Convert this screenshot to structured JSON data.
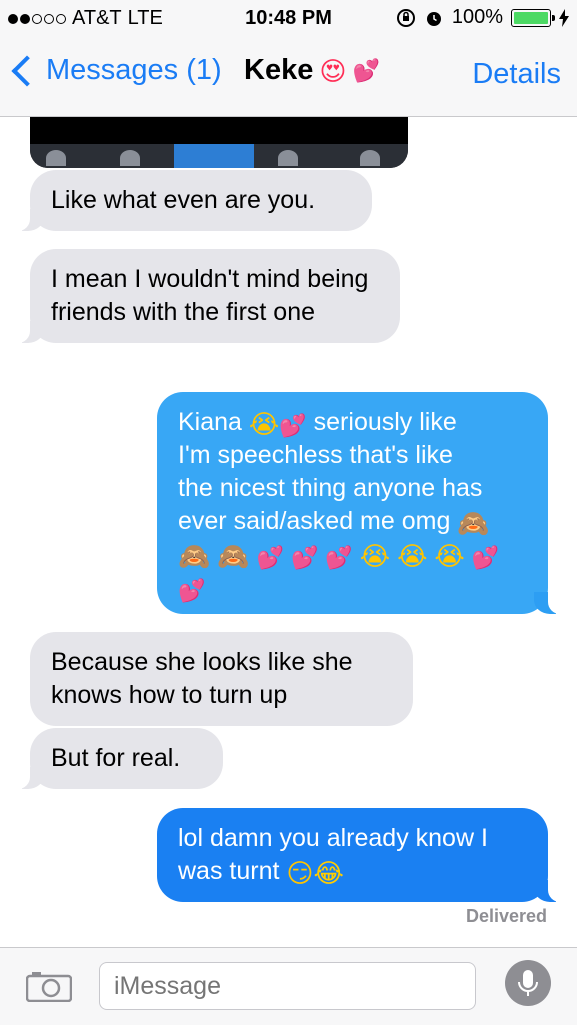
{
  "status_bar": {
    "carrier": "AT&T",
    "network": "LTE",
    "time": "10:48 PM",
    "battery": "100%",
    "battery_level": 1.0,
    "signal_bars": 2
  },
  "nav": {
    "back_label": "Messages (1)",
    "contact_name": "Keke",
    "details_label": "Details"
  },
  "messages": [
    {
      "side": "received",
      "text": "Like what even are you."
    },
    {
      "side": "received",
      "text": "I mean I wouldn't mind being friends with the first one"
    },
    {
      "side": "sent",
      "line1": "Kiana",
      "line1b": "seriously like",
      "line2": "I'm speechless that's like",
      "line3": "the nicest thing anyone has",
      "line4": "ever said/asked me omg"
    },
    {
      "side": "received",
      "text": "Because she looks like she knows how to turn up"
    },
    {
      "side": "received",
      "text": "But for real."
    },
    {
      "side": "sent",
      "line1": "lol damn you already know I",
      "line2": "was turnt"
    }
  ],
  "delivered_label": "Delivered",
  "input": {
    "placeholder": "iMessage"
  },
  "icons": {
    "heart": "💕",
    "heart_eyes": "😍",
    "crying": "😭",
    "see_no_evil": "🙈",
    "smirk": "😏",
    "tears_of_joy": "😂"
  },
  "colors": {
    "accent": "#1a7cf5",
    "received_bubble": "#e5e5ea",
    "sent_bubble": "#1a80f2",
    "sent_bubble_light": "#38a7f5"
  }
}
